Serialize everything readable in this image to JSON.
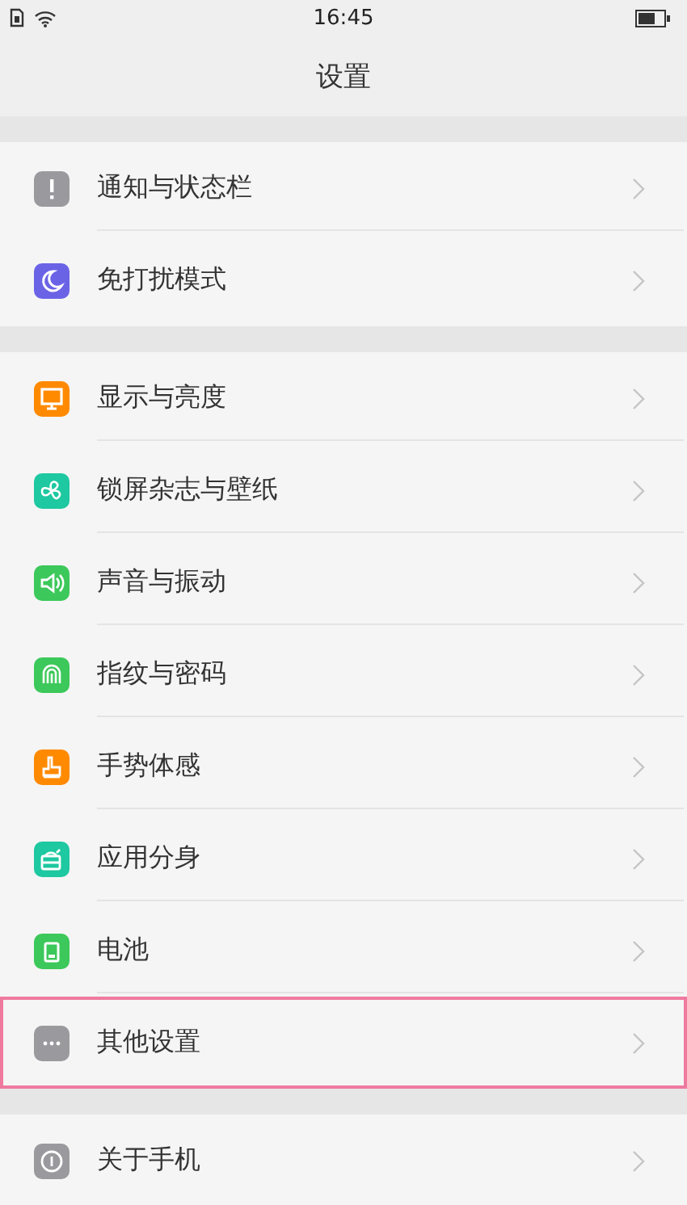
{
  "status_bar": {
    "time": "16:45"
  },
  "title": "设置",
  "groups": [
    {
      "items": [
        {
          "label": "通知与状态栏",
          "color": "#9a9a9e",
          "highlighted": false
        },
        {
          "label": "免打扰模式",
          "color": "#6b63e6",
          "highlighted": false
        }
      ]
    },
    {
      "items": [
        {
          "label": "显示与亮度",
          "color": "#ff8a00",
          "highlighted": false
        },
        {
          "label": "锁屏杂志与壁纸",
          "color": "#1ec8a0",
          "highlighted": false
        },
        {
          "label": "声音与振动",
          "color": "#3cc85a",
          "highlighted": false
        },
        {
          "label": "指纹与密码",
          "color": "#3cc85a",
          "highlighted": false
        },
        {
          "label": "手势体感",
          "color": "#ff8a00",
          "highlighted": false
        },
        {
          "label": "应用分身",
          "color": "#1ec8a0",
          "highlighted": false
        },
        {
          "label": "电池",
          "color": "#3cc85a",
          "highlighted": false
        },
        {
          "label": "其他设置",
          "color": "#9a9a9e",
          "highlighted": true
        }
      ]
    },
    {
      "items": [
        {
          "label": "关于手机",
          "color": "#9a9a9e",
          "highlighted": false
        }
      ]
    }
  ]
}
